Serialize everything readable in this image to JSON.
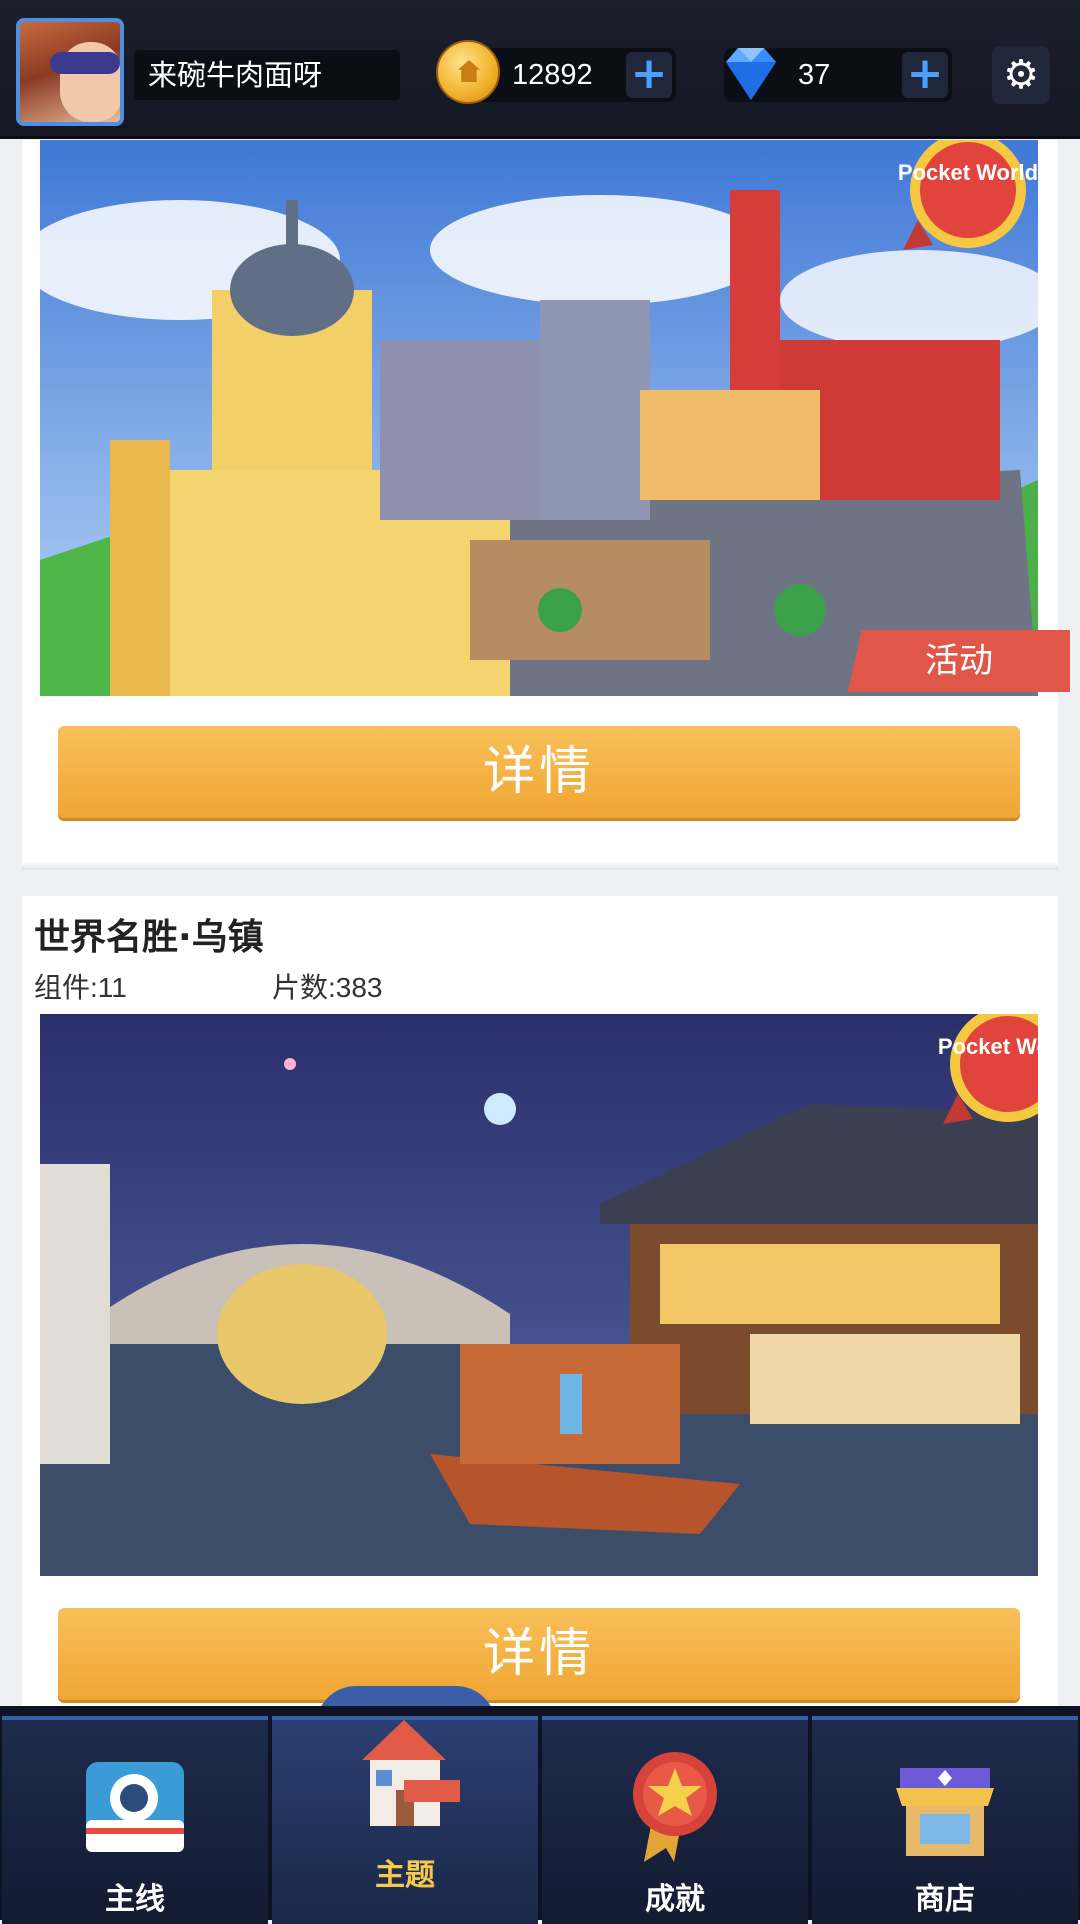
{
  "header": {
    "username": "来碗牛肉面呀",
    "coins": "12892",
    "gems": "37",
    "plus_label": "+"
  },
  "cards": [
    {
      "badge": "Pocket World",
      "tag": "活动",
      "button_label": "详情"
    },
    {
      "title": "世界名胜·乌镇",
      "components_label": "组件:11",
      "pieces_label": "片数:383",
      "badge": "Pocket World",
      "button_label": "详情"
    }
  ],
  "nav": {
    "items": [
      {
        "label": "主线",
        "icon": "camera-icon"
      },
      {
        "label": "主题",
        "icon": "house-icon",
        "active": true
      },
      {
        "label": "成就",
        "icon": "medal-icon"
      },
      {
        "label": "商店",
        "icon": "shop-icon"
      }
    ]
  },
  "colors": {
    "accent_button": "#f4b446",
    "nav_active_label": "#f7c94a",
    "plus": "#4aa0ff",
    "tag": "#e0574a"
  }
}
